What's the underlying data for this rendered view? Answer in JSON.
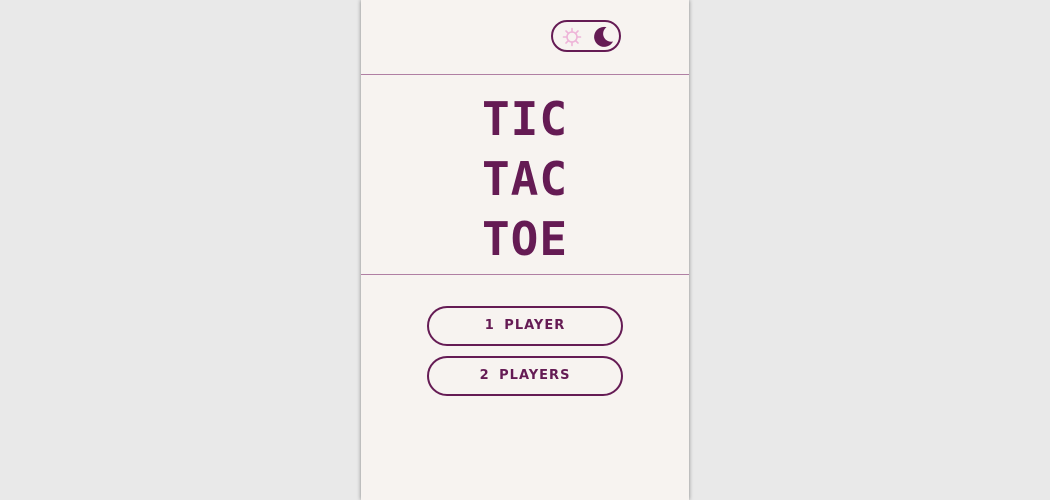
{
  "colors": {
    "accent": "#651b54",
    "sun_icon": "#eeb4d8",
    "background": "#f7f3f0",
    "divider": "#b07fa3",
    "outer_background": "#e9e9e9"
  },
  "header": {
    "theme_toggle": {
      "icons": [
        "sun-icon",
        "moon-icon"
      ],
      "active": "dark"
    }
  },
  "title": {
    "lines": [
      "TIC",
      "TAC",
      "TOE"
    ]
  },
  "menu": {
    "one_player_label": "1 PLAYER",
    "two_players_label": "2 PLAYERS"
  }
}
